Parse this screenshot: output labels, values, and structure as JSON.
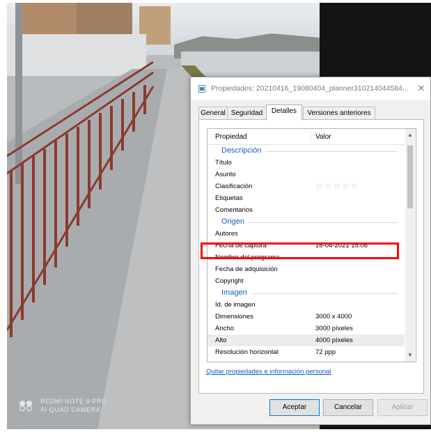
{
  "photo": {
    "watermark_line1": "REDMI NOTE 9 PRO",
    "watermark_line2": "AI QUAD CAMERA"
  },
  "dialog": {
    "title": "Propiedades: 20210416_19080404_planner310214044584...",
    "close_glyph": "✕",
    "tabs": [
      {
        "label": "General",
        "active": false
      },
      {
        "label": "Seguridad",
        "active": false
      },
      {
        "label": "Detalles",
        "active": true
      },
      {
        "label": "Versiones anteriores",
        "active": false
      }
    ],
    "columns": {
      "property": "Propiedad",
      "value": "Valor"
    },
    "sections": {
      "description": "Descripción",
      "origin": "Origen",
      "image": "Imagen"
    },
    "rows": {
      "titulo": {
        "label": "Título",
        "value": ""
      },
      "asunto": {
        "label": "Asunto",
        "value": ""
      },
      "clasificacion": {
        "label": "Clasificación",
        "value": "☆☆☆☆☆",
        "rating": 0
      },
      "etiquetas": {
        "label": "Etiquetas",
        "value": ""
      },
      "comentarios": {
        "label": "Comentarios",
        "value": ""
      },
      "autores": {
        "label": "Autores",
        "value": ""
      },
      "fecha_captura": {
        "label": "Fecha de captura",
        "value": "16-04-2021 15:08"
      },
      "programa": {
        "label": "Nombre del programa",
        "value": ""
      },
      "fecha_adquisicion": {
        "label": "Fecha de adquisición",
        "value": ""
      },
      "copyright": {
        "label": "Copyright",
        "value": ""
      },
      "id_imagen": {
        "label": "Id. de imagen",
        "value": ""
      },
      "dimensiones": {
        "label": "Dimensiones",
        "value": "3000 x 4000"
      },
      "ancho": {
        "label": "Ancho",
        "value": "3000 píxeles"
      },
      "alto": {
        "label": "Alto",
        "value": "4000 píxeles"
      },
      "resolucion_h": {
        "label": "Resolución horizontal",
        "value": "72 ppp"
      }
    },
    "remove_link": "Quitar propiedades e información personal",
    "buttons": {
      "ok": "Aceptar",
      "cancel": "Cancelar",
      "apply": "Aplicar"
    },
    "colors": {
      "highlight_box": "#ff0000",
      "group_title": "#1a5cc8",
      "link": "#0b5bc7"
    }
  }
}
